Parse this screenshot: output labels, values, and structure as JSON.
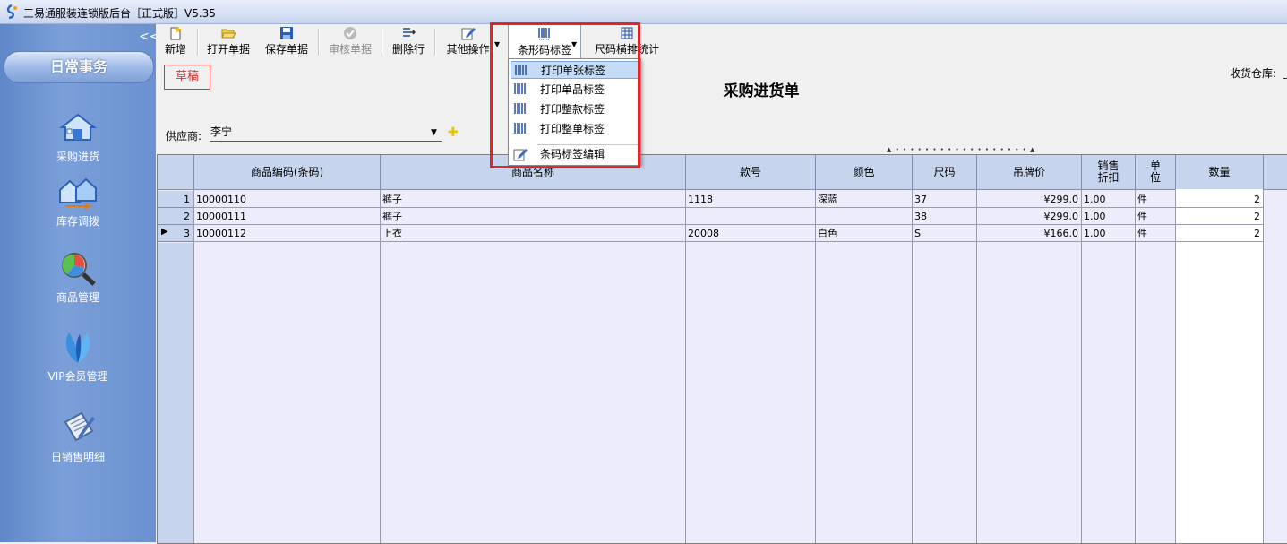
{
  "window": {
    "title": "三易通服装连锁版后台［正式版］V5.35"
  },
  "sidebar": {
    "collapse_label": "<<",
    "header": "日常事务",
    "items": [
      {
        "label": "采购进货",
        "icon": "house-icon"
      },
      {
        "label": "库存调拨",
        "icon": "transfer-houses-icon"
      },
      {
        "label": "商品管理",
        "icon": "magnifier-chart-icon"
      },
      {
        "label": "VIP会员管理",
        "icon": "vip-leaves-icon"
      },
      {
        "label": "日销售明细",
        "icon": "clipboard-pen-icon"
      }
    ]
  },
  "toolbar": {
    "new": "新增",
    "open": "打开单据",
    "save": "保存单据",
    "audit": "审核单据",
    "delete_row": "删除行",
    "other": "其他操作",
    "barcode": "条形码标签",
    "size_stats": "尺码横排统计"
  },
  "barcode_menu": [
    {
      "label": "打印单张标签",
      "selected": true
    },
    {
      "label": "打印单品标签",
      "selected": false
    },
    {
      "label": "打印整款标签",
      "selected": false
    },
    {
      "label": "打印整单标签",
      "selected": false
    },
    {
      "label": "条码标签编辑",
      "selected": false
    }
  ],
  "form": {
    "status": "草稿",
    "title": "采购进货单",
    "warehouse_label": "收货仓库:",
    "supplier_label": "供应商:",
    "supplier_value": "李宁"
  },
  "grid": {
    "columns": [
      "商品编码(条码)",
      "商品名称",
      "款号",
      "颜色",
      "尺码",
      "吊牌价",
      "销售折扣",
      "单位",
      "数量"
    ],
    "column_display": [
      "商品编码(条码)",
      "商品名称",
      "款号",
      "颜色",
      "尺码",
      "吊牌价",
      "销售\n折扣",
      "单\n位",
      "数量"
    ],
    "rows": [
      {
        "no": "1",
        "code": "10000110",
        "name": "裤子",
        "style": "1118",
        "color": "深蓝",
        "size": "37",
        "price": "¥299.0",
        "discount": "1.00",
        "unit": "件",
        "qty": "2"
      },
      {
        "no": "2",
        "code": "10000111",
        "name": "裤子",
        "style": "",
        "color": "",
        "size": "38",
        "price": "¥299.0",
        "discount": "1.00",
        "unit": "件",
        "qty": "2"
      },
      {
        "no": "3",
        "code": "10000112",
        "name": "上衣",
        "style": "20008",
        "color": "白色",
        "size": "S",
        "price": "¥166.0",
        "discount": "1.00",
        "unit": "件",
        "qty": "2"
      }
    ],
    "current_row": 3
  }
}
